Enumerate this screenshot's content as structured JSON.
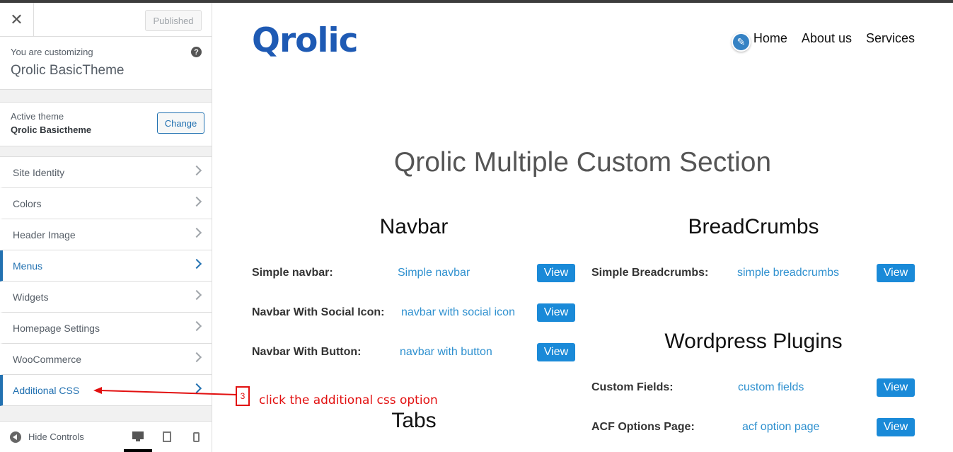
{
  "sidebar": {
    "close_icon": "close-icon",
    "published_label": "Published",
    "customizing_label": "You are customizing",
    "theme_name": "Qrolic BasicTheme",
    "active_theme_label": "Active theme",
    "active_theme_name": "Qrolic Basictheme",
    "change_label": "Change",
    "items": [
      {
        "label": "Site Identity"
      },
      {
        "label": "Colors"
      },
      {
        "label": "Header Image"
      },
      {
        "label": "Menus"
      },
      {
        "label": "Widgets"
      },
      {
        "label": "Homepage Settings"
      },
      {
        "label": "WooCommerce"
      },
      {
        "label": "Additional CSS"
      }
    ],
    "hide_controls_label": "Hide Controls"
  },
  "preview": {
    "logo": "Qrolic",
    "nav": [
      "Home",
      "About us",
      "Services"
    ],
    "main_title": "Qrolic Multiple Custom Section",
    "navbar_section": {
      "title": "Navbar",
      "rows": [
        {
          "label": "Simple navbar:",
          "link": "Simple navbar",
          "button": "View"
        },
        {
          "label": "Navbar With Social Icon:",
          "link": "navbar with social icon",
          "button": "View"
        },
        {
          "label": "Navbar With Button:",
          "link": "navbar with button",
          "button": "View"
        }
      ]
    },
    "tabs_section": {
      "title": "Tabs"
    },
    "breadcrumbs_section": {
      "title": "BreadCrumbs",
      "rows": [
        {
          "label": "Simple Breadcrumbs:",
          "link": "simple breadcrumbs",
          "button": "View"
        }
      ]
    },
    "plugins_section": {
      "title": "Wordpress Plugins",
      "rows": [
        {
          "label": "Custom Fields:",
          "link": "custom fields",
          "button": "View"
        },
        {
          "label": "ACF Options Page:",
          "link": "acf option page",
          "button": "View"
        }
      ]
    }
  },
  "annotation": {
    "step": "3",
    "text": "click the additional css option",
    "color": "#e21010"
  },
  "colors": {
    "accent": "#2271b1",
    "link": "#2e90cf",
    "button": "#1a8ad8",
    "logo": "#1e5ab4"
  }
}
